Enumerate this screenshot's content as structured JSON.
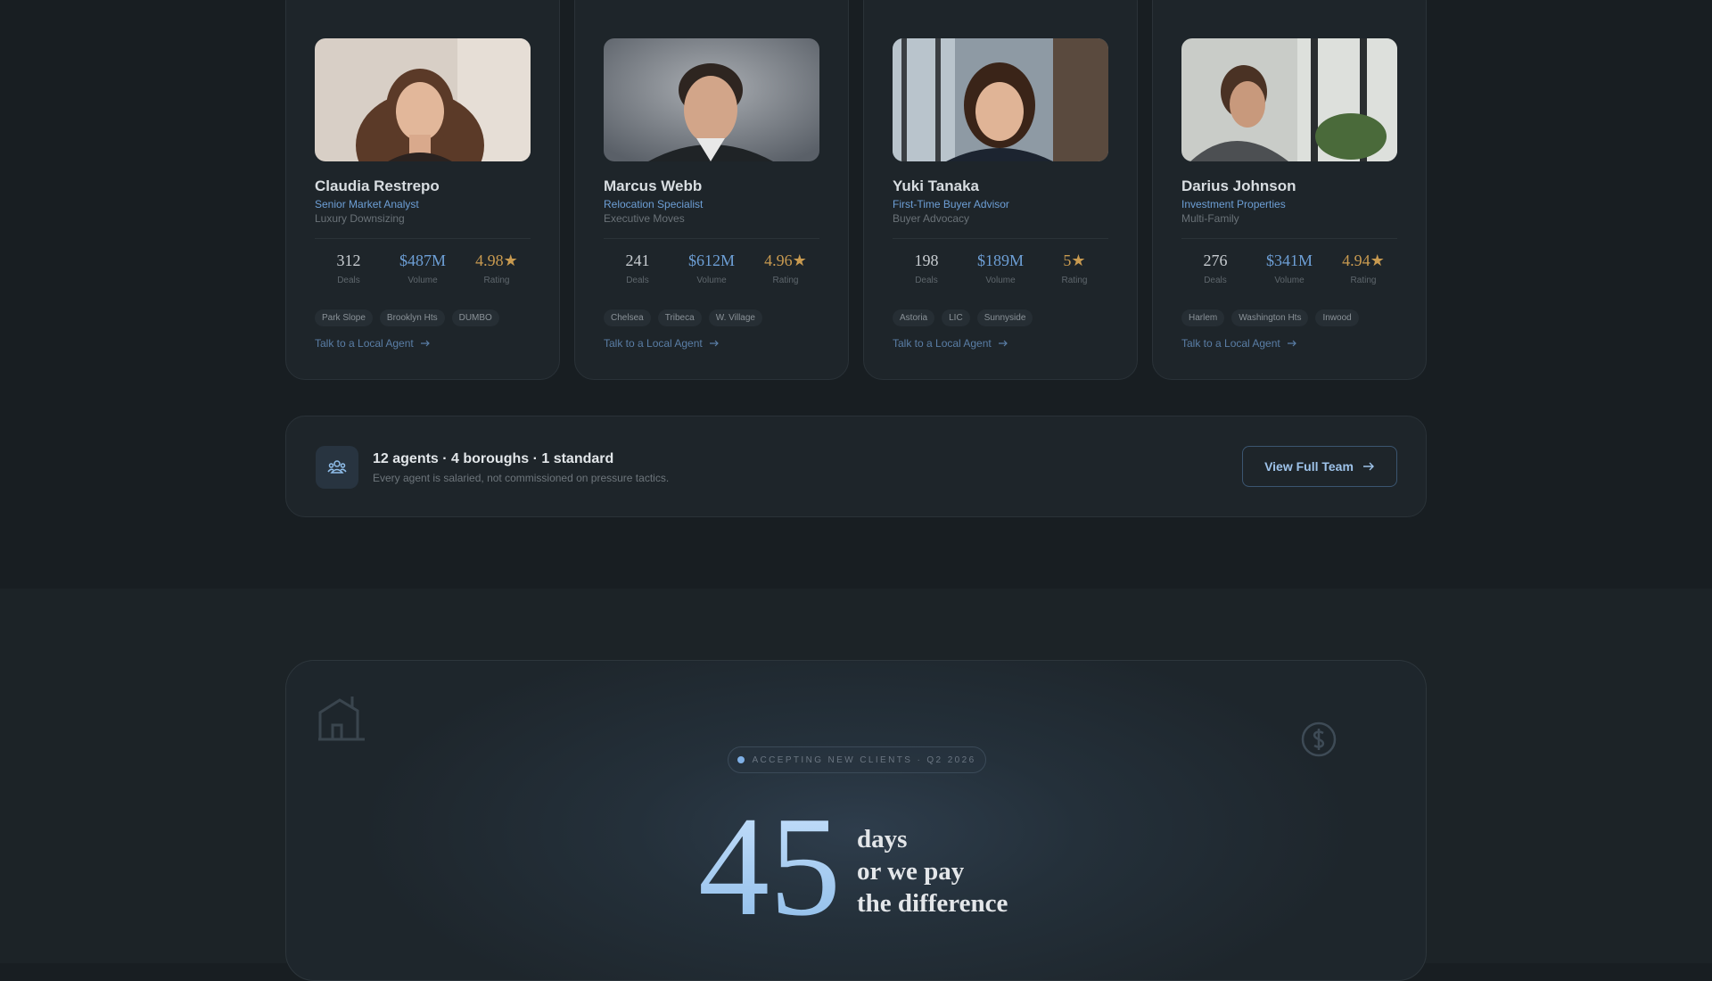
{
  "agents": [
    {
      "name": "Claudia Restrepo",
      "role": "Senior Market Analyst",
      "specialty": "Luxury Downsizing",
      "stats": [
        {
          "value": "312",
          "label": "Deals"
        },
        {
          "value": "$487M",
          "label": "Volume"
        },
        {
          "value": "4.98★",
          "label": "Rating"
        }
      ],
      "tags": [
        "Park Slope",
        "Brooklyn Hts",
        "DUMBO"
      ],
      "cta": "Talk to a Local Agent"
    },
    {
      "name": "Marcus Webb",
      "role": "Relocation Specialist",
      "specialty": "Executive Moves",
      "stats": [
        {
          "value": "241",
          "label": "Deals"
        },
        {
          "value": "$612M",
          "label": "Volume"
        },
        {
          "value": "4.96★",
          "label": "Rating"
        }
      ],
      "tags": [
        "Chelsea",
        "Tribeca",
        "W. Village"
      ],
      "cta": "Talk to a Local Agent"
    },
    {
      "name": "Yuki Tanaka",
      "role": "First-Time Buyer Advisor",
      "specialty": "Buyer Advocacy",
      "stats": [
        {
          "value": "198",
          "label": "Deals"
        },
        {
          "value": "$189M",
          "label": "Volume"
        },
        {
          "value": "5★",
          "label": "Rating"
        }
      ],
      "tags": [
        "Astoria",
        "LIC",
        "Sunnyside"
      ],
      "cta": "Talk to a Local Agent"
    },
    {
      "name": "Darius Johnson",
      "role": "Investment Properties",
      "specialty": "Multi-Family",
      "stats": [
        {
          "value": "276",
          "label": "Deals"
        },
        {
          "value": "$341M",
          "label": "Volume"
        },
        {
          "value": "4.94★",
          "label": "Rating"
        }
      ],
      "tags": [
        "Harlem",
        "Washington Hts",
        "Inwood"
      ],
      "cta": "Talk to a Local Agent"
    }
  ],
  "team": {
    "title": "12 agents · 4 boroughs · 1 standard",
    "subtitle": "Every agent is salaried, not commissioned on pressure tactics.",
    "button": "View Full Team"
  },
  "promo": {
    "badge": "ACCEPTING NEW CLIENTS · Q2 2026",
    "number": "45",
    "lines": [
      "days",
      "or we pay",
      "the difference"
    ]
  },
  "colors": {
    "accent": "#6d9fd6",
    "rating": "#c89a50",
    "background": "#181e22"
  },
  "icons": [
    "team-icon",
    "arrow-right-icon",
    "house-icon",
    "dollar-icon"
  ]
}
